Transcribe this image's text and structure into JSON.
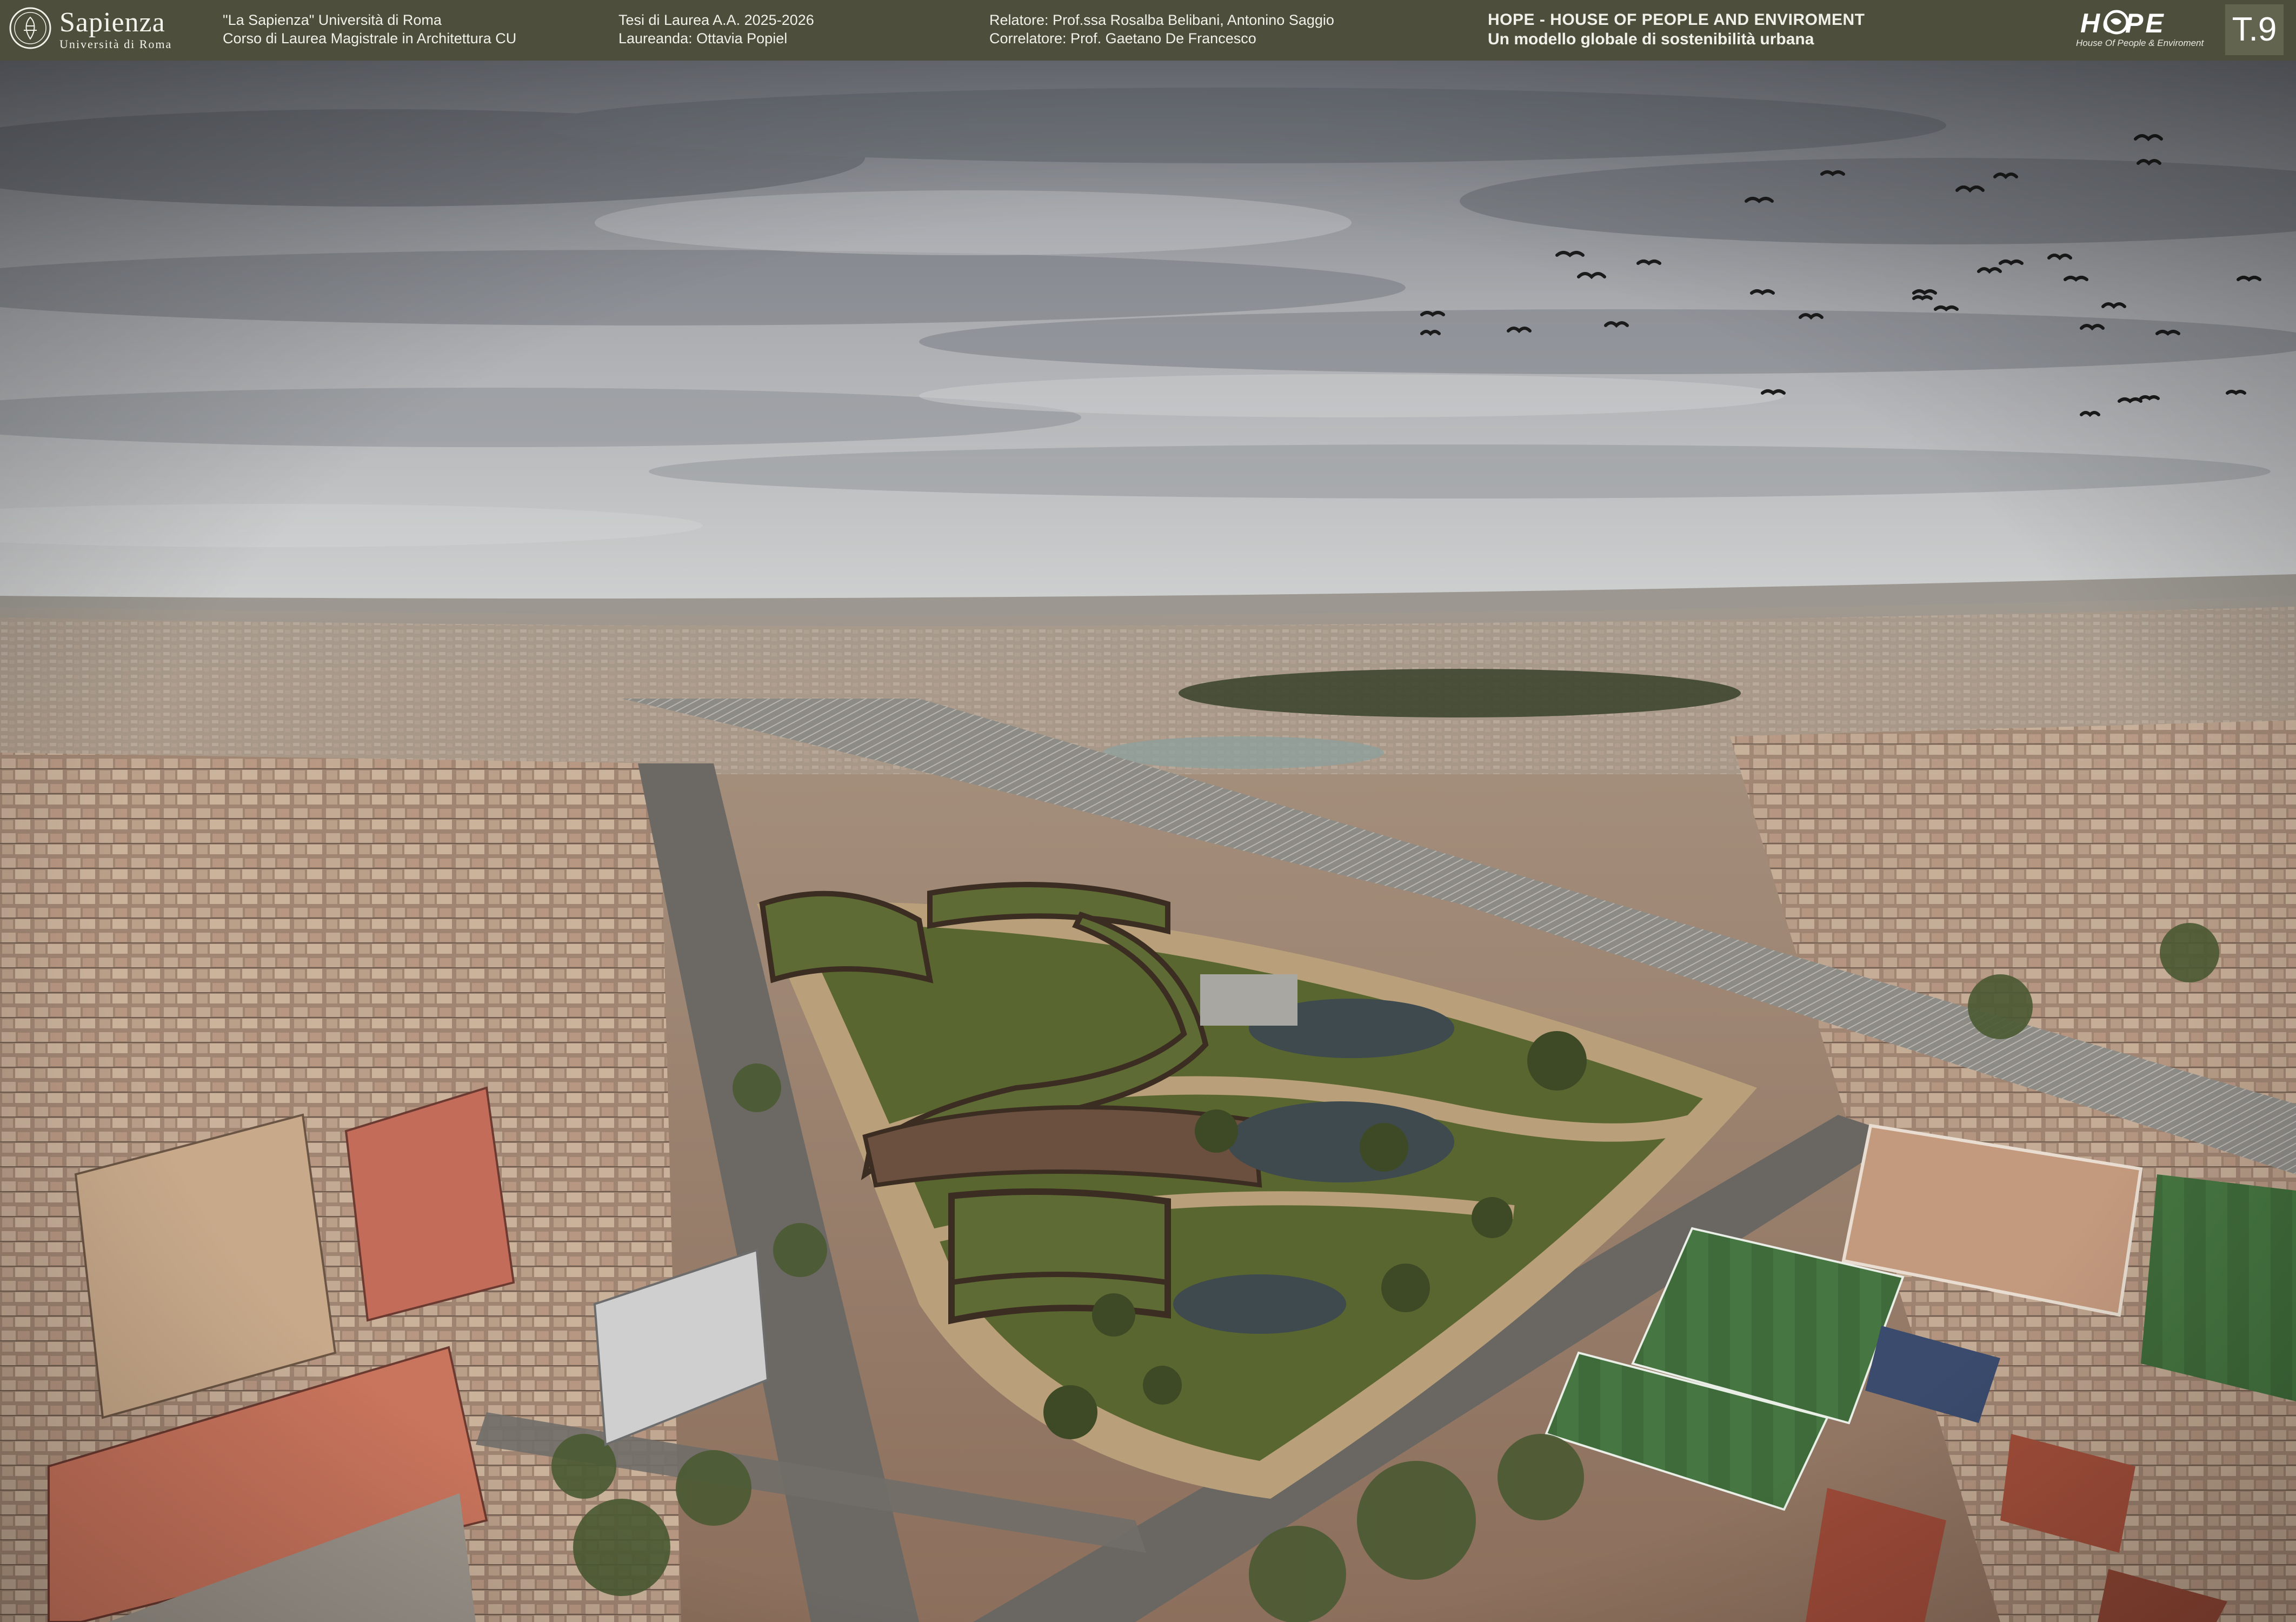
{
  "header": {
    "university": {
      "name": "Sapienza",
      "subname": "Università di Roma"
    },
    "course": {
      "line1": "\"La  Sapienza\"  Università di Roma",
      "line2": "Corso di Laurea Magistrale in Architettura CU"
    },
    "thesis": {
      "line1": "Tesi di Laurea A.A. 2025-2026",
      "line2": "Laureanda: Ottavia Popiel"
    },
    "supervisors": {
      "line1": "Relatore: Prof.ssa Rosalba Belibani, Antonino Saggio",
      "line2": " Correlatore: Prof. Gaetano De Francesco"
    },
    "project": {
      "title": "HOPE - HOUSE OF PEOPLE AND ENVIROMENT",
      "subtitle": "Un modello globale di sostenibilità urbana"
    },
    "logo": {
      "word": "HOPE",
      "tagline": "House Of People & Enviroment",
      "icon": "globe-o-icon"
    },
    "sheet_number": "T.9"
  },
  "photo": {
    "icon": "aerial-city-photo",
    "colors": {
      "sky_top": "#7d8188",
      "sky_bottom": "#c4c6c8",
      "horizon": "#9c9891",
      "city": "#a48f7c",
      "green_roof": "#5f6b34",
      "path": "#b9a07a",
      "pond": "#3f4a4e",
      "pitch": "#c49a7e",
      "football_field": "#3f6b3a",
      "rail": "#8d8b86"
    }
  }
}
